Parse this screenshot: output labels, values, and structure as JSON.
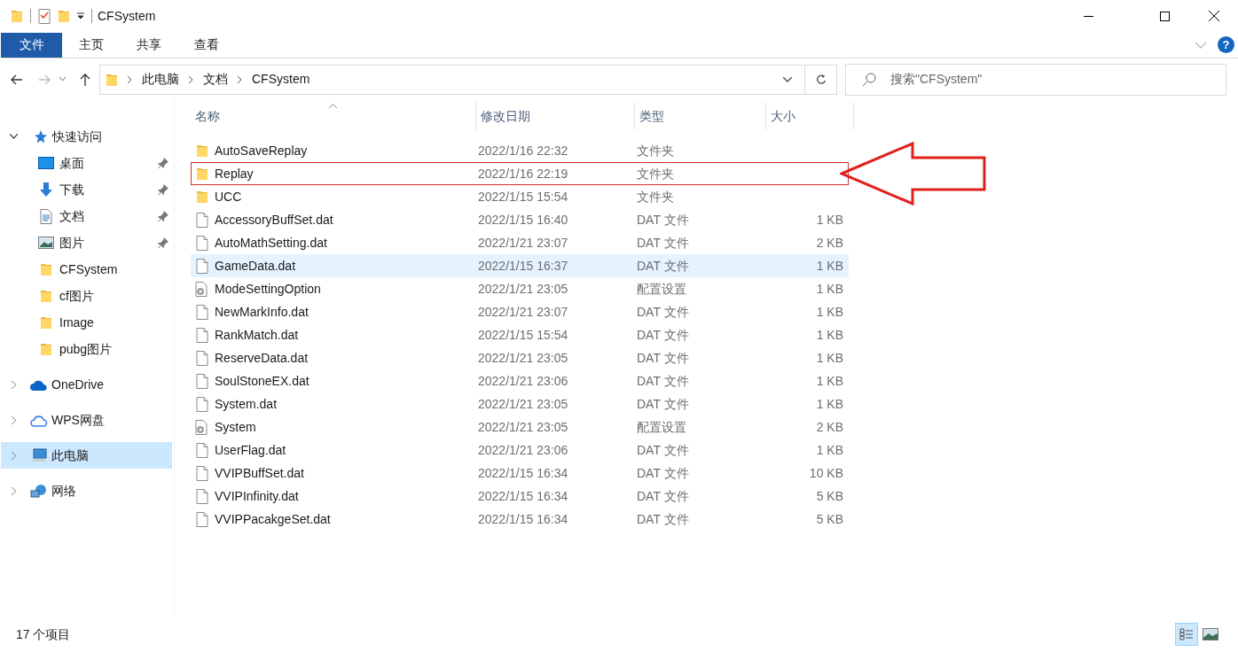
{
  "window": {
    "title": "CFSystem"
  },
  "ribbon_tabs": [
    {
      "label": "文件",
      "selected": true
    },
    {
      "label": "主页",
      "selected": false
    },
    {
      "label": "共享",
      "selected": false
    },
    {
      "label": "查看",
      "selected": false
    }
  ],
  "help_button": {
    "label": "?"
  },
  "address": {
    "crumbs": [
      "此电脑",
      "文档",
      "CFSystem"
    ]
  },
  "search": {
    "placeholder": "搜索\"CFSystem\""
  },
  "sidebar": {
    "items": [
      {
        "label": "快速访问",
        "kind": "quick",
        "expanded": true,
        "selected": false,
        "children": [
          {
            "label": "桌面",
            "kind": "desktop",
            "pinned": true
          },
          {
            "label": "下载",
            "kind": "download",
            "pinned": true
          },
          {
            "label": "文档",
            "kind": "document",
            "pinned": true
          },
          {
            "label": "图片",
            "kind": "picture",
            "pinned": true
          },
          {
            "label": "CFSystem",
            "kind": "folder",
            "pinned": false
          },
          {
            "label": "cf图片",
            "kind": "folder",
            "pinned": false
          },
          {
            "label": "Image",
            "kind": "folder",
            "pinned": false
          },
          {
            "label": "pubg图片",
            "kind": "folder",
            "pinned": false
          }
        ]
      },
      {
        "label": "OneDrive",
        "kind": "onedrive",
        "expanded": false,
        "selected": false
      },
      {
        "label": "WPS网盘",
        "kind": "wps",
        "expanded": false,
        "selected": false
      },
      {
        "label": "此电脑",
        "kind": "pc",
        "expanded": false,
        "selected": true
      },
      {
        "label": "网络",
        "kind": "network",
        "expanded": false,
        "selected": false
      }
    ]
  },
  "table": {
    "columns": [
      "名称",
      "修改日期",
      "类型",
      "大小"
    ],
    "rows": [
      {
        "kind": "folder",
        "name": "AutoSaveReplay",
        "date": "2022/1/16 22:32",
        "type": "文件夹",
        "hovered": false,
        "annotated": false
      },
      {
        "kind": "folder",
        "name": "Replay",
        "date": "2022/1/16 22:19",
        "type": "文件夹",
        "hovered": false,
        "annotated": true
      },
      {
        "kind": "folder",
        "name": "UCC",
        "date": "2022/1/15 15:54",
        "type": "文件夹",
        "hovered": false,
        "annotated": false
      },
      {
        "kind": "file",
        "name": "AccessoryBuffSet.dat",
        "date": "2022/1/15 16:40",
        "type": "DAT 文件",
        "size": "1 KB",
        "hovered": false,
        "annotated": false
      },
      {
        "kind": "file",
        "name": "AutoMathSetting.dat",
        "date": "2022/1/21 23:07",
        "type": "DAT 文件",
        "size": "2 KB",
        "hovered": false,
        "annotated": false
      },
      {
        "kind": "file",
        "name": "GameData.dat",
        "date": "2022/1/15 16:37",
        "type": "DAT 文件",
        "size": "1 KB",
        "hovered": true,
        "annotated": false
      },
      {
        "kind": "config",
        "name": "ModeSettingOption",
        "date": "2022/1/21 23:05",
        "type": "配置设置",
        "size": "1 KB",
        "hovered": false,
        "annotated": false
      },
      {
        "kind": "file",
        "name": "NewMarkInfo.dat",
        "date": "2022/1/21 23:07",
        "type": "DAT 文件",
        "size": "1 KB",
        "hovered": false,
        "annotated": false
      },
      {
        "kind": "file",
        "name": "RankMatch.dat",
        "date": "2022/1/15 15:54",
        "type": "DAT 文件",
        "size": "1 KB",
        "hovered": false,
        "annotated": false
      },
      {
        "kind": "file",
        "name": "ReserveData.dat",
        "date": "2022/1/21 23:05",
        "type": "DAT 文件",
        "size": "1 KB",
        "hovered": false,
        "annotated": false
      },
      {
        "kind": "file",
        "name": "SoulStoneEX.dat",
        "date": "2022/1/21 23:06",
        "type": "DAT 文件",
        "size": "1 KB",
        "hovered": false,
        "annotated": false
      },
      {
        "kind": "file",
        "name": "System.dat",
        "date": "2022/1/21 23:05",
        "type": "DAT 文件",
        "size": "1 KB",
        "hovered": false,
        "annotated": false
      },
      {
        "kind": "config",
        "name": "System",
        "date": "2022/1/21 23:05",
        "type": "配置设置",
        "size": "2 KB",
        "hovered": false,
        "annotated": false
      },
      {
        "kind": "file",
        "name": "UserFlag.dat",
        "date": "2022/1/21 23:06",
        "type": "DAT 文件",
        "size": "1 KB",
        "hovered": false,
        "annotated": false
      },
      {
        "kind": "file",
        "name": "VVIPBuffSet.dat",
        "date": "2022/1/15 16:34",
        "type": "DAT 文件",
        "size": "10 KB",
        "hovered": false,
        "annotated": false
      },
      {
        "kind": "file",
        "name": "VVIPInfinity.dat",
        "date": "2022/1/15 16:34",
        "type": "DAT 文件",
        "size": "5 KB",
        "hovered": false,
        "annotated": false
      },
      {
        "kind": "file",
        "name": "VVIPPacakgeSet.dat",
        "date": "2022/1/15 16:34",
        "type": "DAT 文件",
        "size": "5 KB",
        "hovered": false,
        "annotated": false
      }
    ]
  },
  "status_bar": {
    "count": "17 个项目"
  }
}
